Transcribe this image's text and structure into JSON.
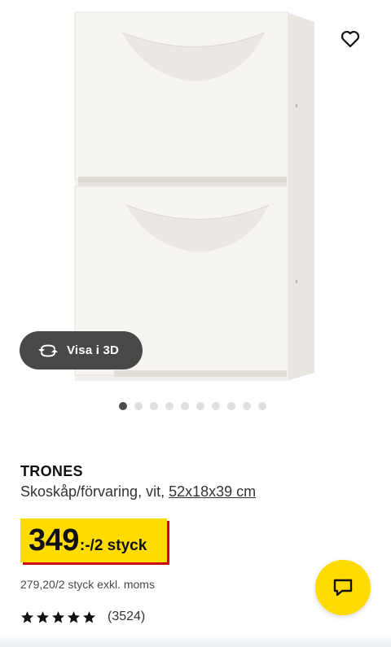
{
  "product": {
    "name": "TRONES",
    "description": "Skoskåp/förvaring, vit, ",
    "dimensions": "52x18x39 cm",
    "price_main": "349",
    "price_suffix": ":-/2 styck",
    "price_excl_vat": "279,20/2 styck exkl. moms",
    "rating_count": "(3524)",
    "rating_stars": 5
  },
  "gallery": {
    "view_3d_label": "Visa i 3D",
    "image_count": 10,
    "active_index": 0
  },
  "icons": {
    "favorite": "heart-outline-icon",
    "rotate_3d": "rotate-arrows-icon",
    "chat": "chat-bubble-icon",
    "star": "star-icon"
  },
  "colors": {
    "price_yellow": "#ffdb00",
    "price_shadow_red": "#cc0008",
    "pill_dark": "#484848",
    "dot_active": "#4a4a4a",
    "dot_inactive": "#dfdfdf"
  }
}
